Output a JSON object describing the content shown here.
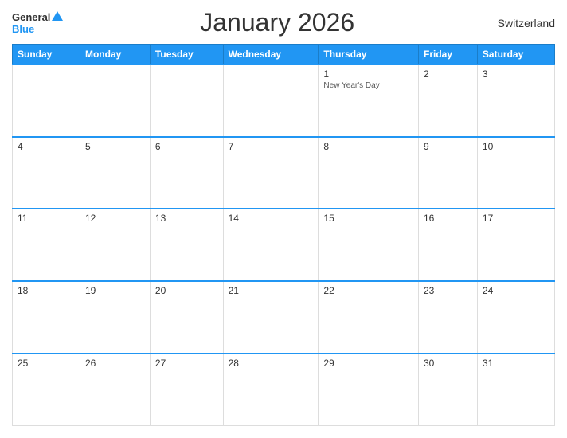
{
  "header": {
    "logo": {
      "general": "General",
      "blue": "Blue",
      "triangle_color": "#2196F3"
    },
    "title": "January 2026",
    "country": "Switzerland"
  },
  "calendar": {
    "days_of_week": [
      "Sunday",
      "Monday",
      "Tuesday",
      "Wednesday",
      "Thursday",
      "Friday",
      "Saturday"
    ],
    "weeks": [
      [
        {
          "day": "",
          "empty": true
        },
        {
          "day": "",
          "empty": true
        },
        {
          "day": "",
          "empty": true
        },
        {
          "day": "",
          "empty": true
        },
        {
          "day": "1",
          "holiday": "New Year's Day"
        },
        {
          "day": "2",
          "holiday": ""
        },
        {
          "day": "3",
          "holiday": ""
        }
      ],
      [
        {
          "day": "4"
        },
        {
          "day": "5"
        },
        {
          "day": "6"
        },
        {
          "day": "7"
        },
        {
          "day": "8"
        },
        {
          "day": "9"
        },
        {
          "day": "10"
        }
      ],
      [
        {
          "day": "11"
        },
        {
          "day": "12"
        },
        {
          "day": "13"
        },
        {
          "day": "14"
        },
        {
          "day": "15"
        },
        {
          "day": "16"
        },
        {
          "day": "17"
        }
      ],
      [
        {
          "day": "18"
        },
        {
          "day": "19"
        },
        {
          "day": "20"
        },
        {
          "day": "21"
        },
        {
          "day": "22"
        },
        {
          "day": "23"
        },
        {
          "day": "24"
        }
      ],
      [
        {
          "day": "25"
        },
        {
          "day": "26"
        },
        {
          "day": "27"
        },
        {
          "day": "28"
        },
        {
          "day": "29"
        },
        {
          "day": "30"
        },
        {
          "day": "31"
        }
      ]
    ]
  }
}
